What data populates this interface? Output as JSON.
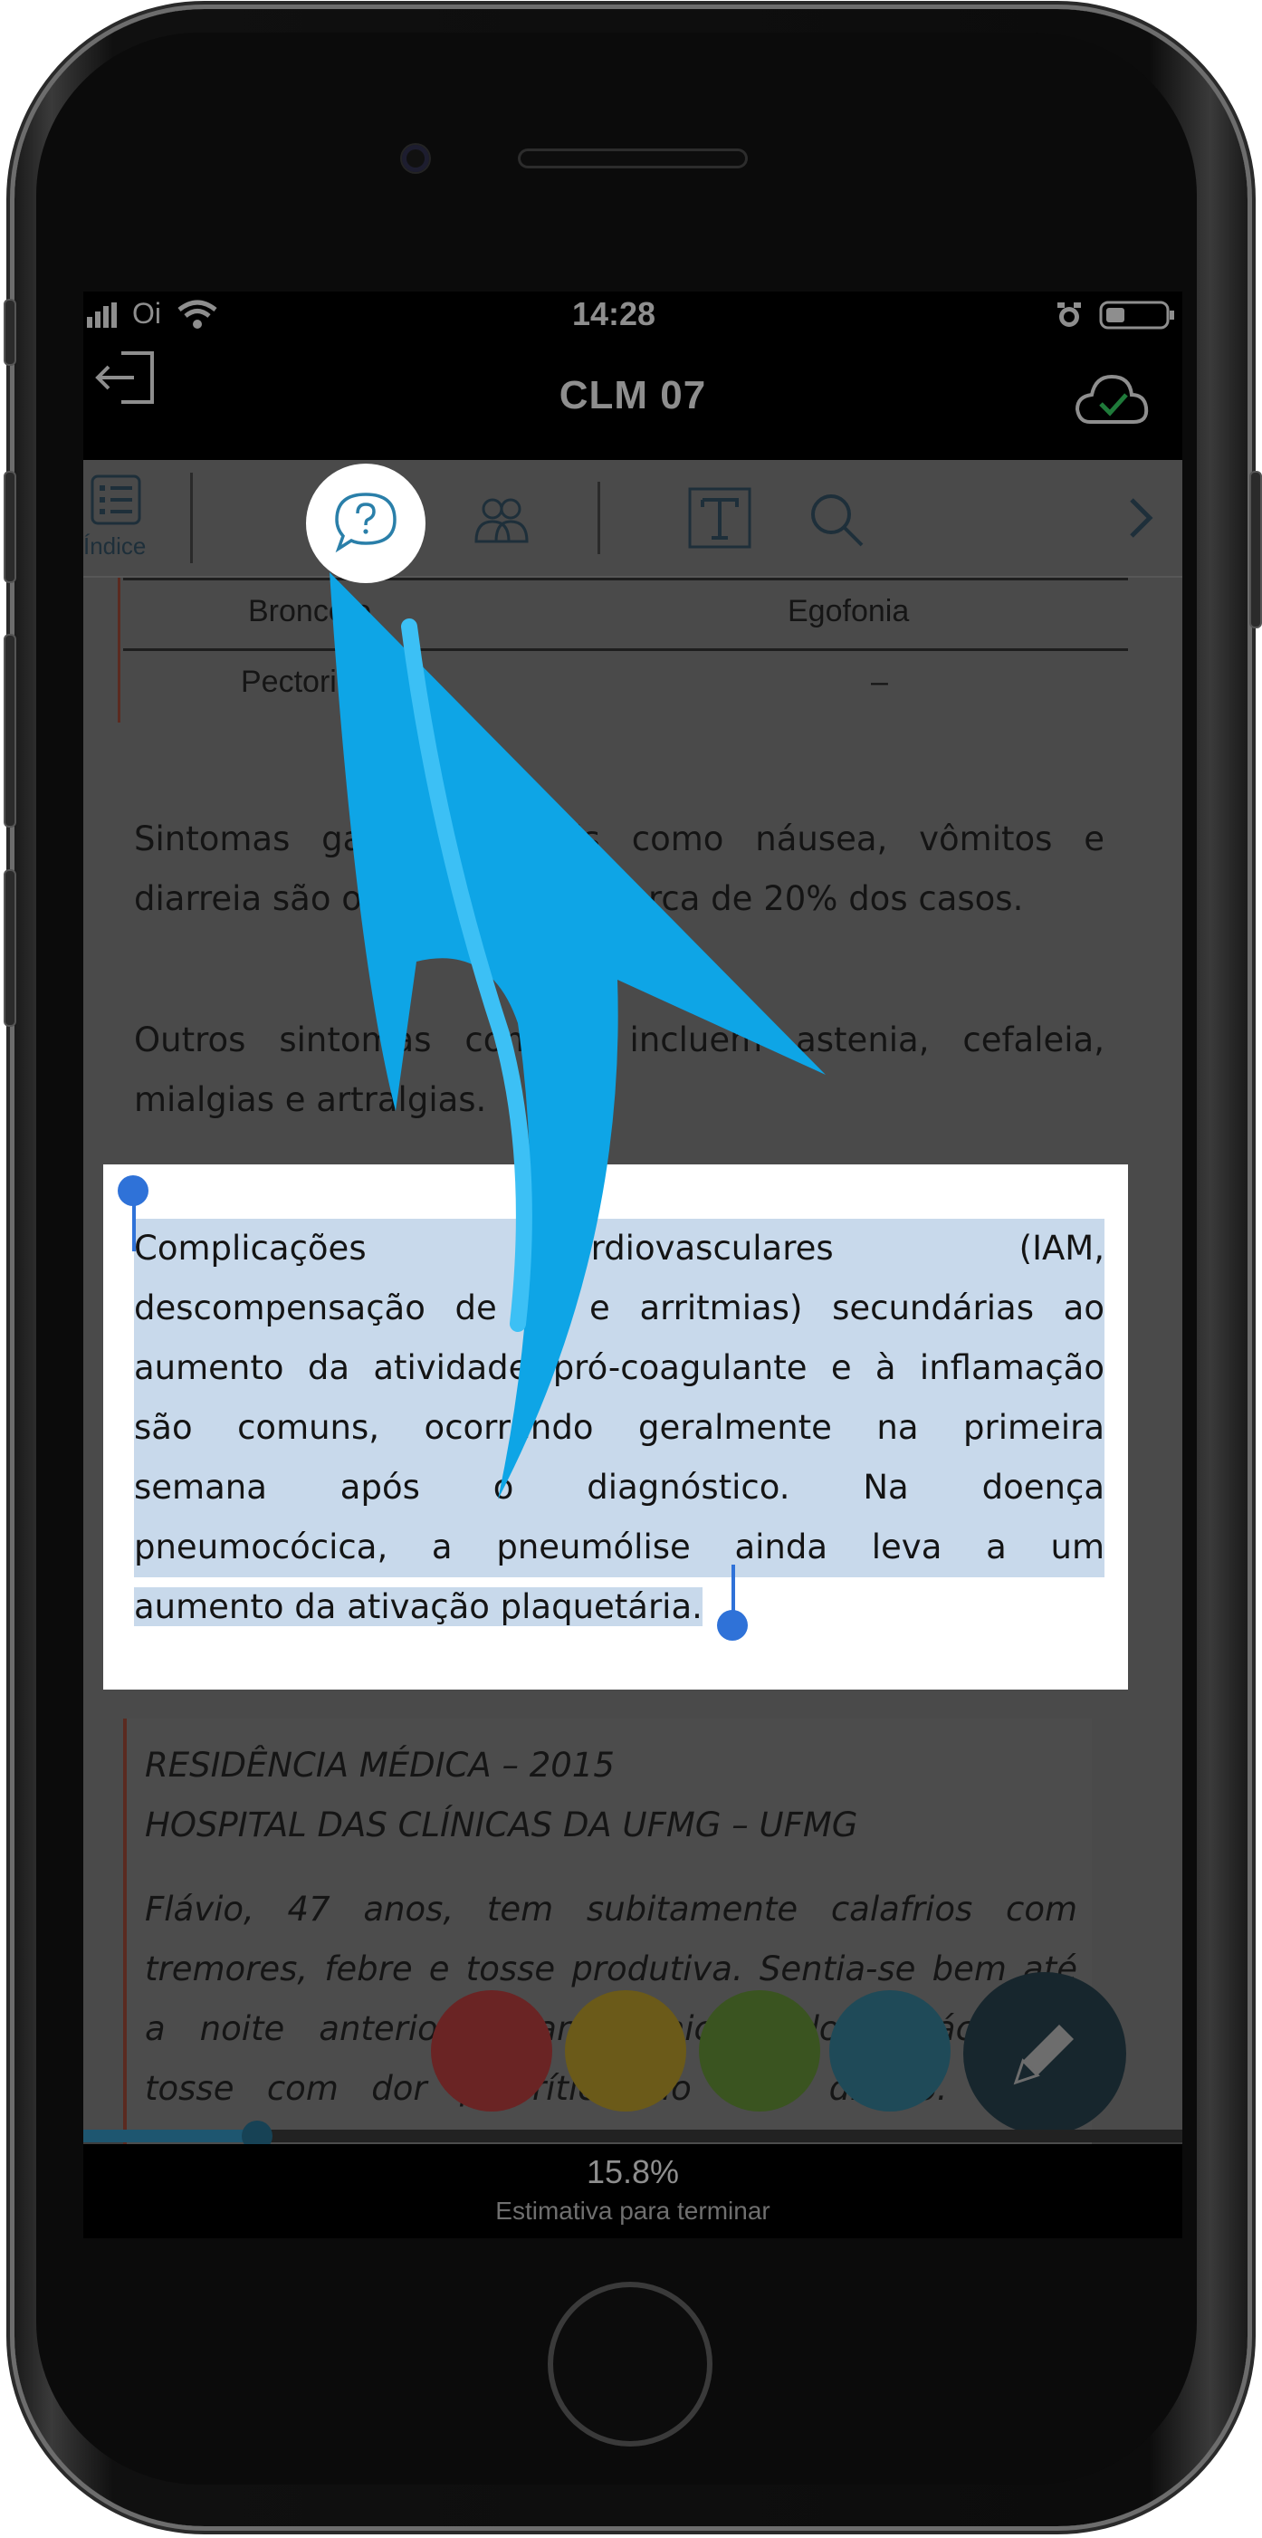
{
  "status_bar": {
    "carrier": "Oi",
    "time": "14:28"
  },
  "header": {
    "title": "CLM 07"
  },
  "toolbar": {
    "index_label": "Índice"
  },
  "table": {
    "rows": [
      {
        "left": "Broncofo",
        "right": "Egofonia"
      },
      {
        "left": "Pectorilóq",
        "right": "–"
      }
    ]
  },
  "paragraphs": {
    "p1": "Sintomas gastrointestinais como náusea, vômitos e diarreia são observados em cerca de 20% dos casos.",
    "p1_line1": "Sintomas gastrointestinais como náusea, vômitos e",
    "p1_line2": "diarreia são observados em cerca de 20% dos casos.",
    "p2_line1": "Outros sintomas comuns incluem astenia, cefaleia,",
    "p2_line2": "mialgias e artralgias."
  },
  "selection": {
    "lines": [
      "Complicações cardiovasculares (IAM,",
      "descompensação de IC e arritmias) secundárias ao",
      "aumento da atividade pró-coagulante e à inflamação",
      "são comuns, ocorrendo geralmente na primeira",
      "semana após o diagnóstico. Na doença",
      "pneumocócica, a pneumólise ainda leva a um",
      "aumento da ativação plaquetária."
    ]
  },
  "question": {
    "source_line1": "RESIDÊNCIA MÉDICA – 2015",
    "source_line2": "HOSPITAL DAS CLÍNICAS DA UFMG – UFMG",
    "lines": [
      "Flávio, 47 anos, tem subitamente calafrios com",
      "tremores, febre e tosse produtiva. Sentia-se bem até",
      "a noite anterior, quando iniciou dor torácica e",
      "tosse com dor pleurítica do lado direito. Ao e"
    ]
  },
  "highlight_colors": [
    "#6a2424",
    "#6b5a19",
    "#3a5420",
    "#1f4a58"
  ],
  "accent": {
    "arrow": "#0ea5e6",
    "selection_handle": "#2f72d8",
    "progress": "#1e5670"
  },
  "progress": {
    "value_percent": 15.8,
    "percent_text": "15.8%",
    "caption": "Estimativa para terminar"
  }
}
